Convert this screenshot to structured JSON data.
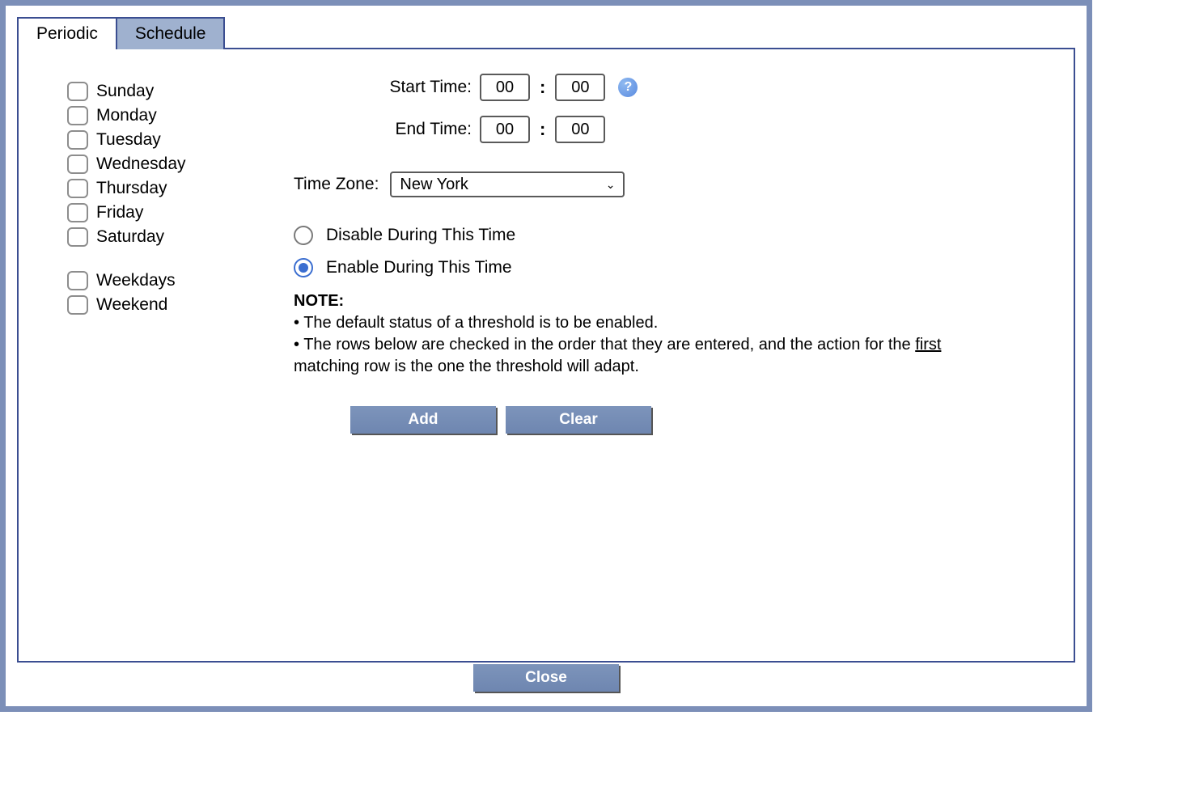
{
  "tabs": {
    "periodic": "Periodic",
    "schedule": "Schedule"
  },
  "days": {
    "sunday": "Sunday",
    "monday": "Monday",
    "tuesday": "Tuesday",
    "wednesday": "Wednesday",
    "thursday": "Thursday",
    "friday": "Friday",
    "saturday": "Saturday",
    "weekdays": "Weekdays",
    "weekend": "Weekend"
  },
  "time": {
    "start_label": "Start Time:",
    "end_label": "End Time:",
    "start_hh": "00",
    "start_mm": "00",
    "end_hh": "00",
    "end_mm": "00",
    "colon": ":"
  },
  "timezone": {
    "label": "Time Zone:",
    "selected": "New York"
  },
  "radios": {
    "disable": "Disable During This Time",
    "enable": "Enable During This Time"
  },
  "note": {
    "title": "NOTE:",
    "b1_pre": "• The default status of a threshold is to be enabled.",
    "b2_pre": "• The rows below are checked in the order that they are entered, and the action for the ",
    "b2_u": "first",
    "b2_post": " matching row is the one the threshold will adapt."
  },
  "buttons": {
    "add": "Add",
    "clear": "Clear",
    "close": "Close"
  },
  "help": "?"
}
